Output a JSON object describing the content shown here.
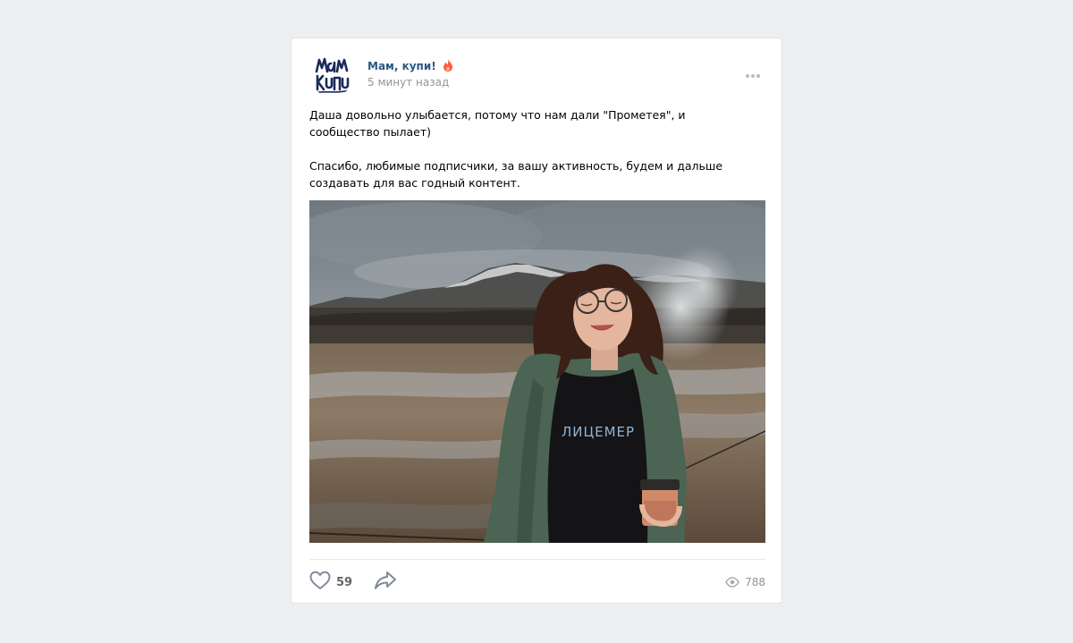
{
  "post": {
    "author": "Мам, купи!",
    "time": "5 минут назад",
    "avatar_text": "мам купи",
    "text_paragraphs": [
      "Даша довольно улыбается, потому что нам дали \"Прометея\", и сообщество пылает)",
      "Спасибо, любимые подписчики, за вашу активность, будем и дальше создавать для вас годный контент."
    ],
    "photo": {
      "shirt_text": "ЛИЦЕМЕР"
    },
    "likes": "59",
    "views": "788"
  },
  "icons": {
    "author_badge": "flame-icon",
    "menu": "more-dots-icon",
    "like": "heart-icon",
    "share": "share-arrow-icon",
    "views": "eye-icon"
  },
  "colors": {
    "page_bg": "#edeef0",
    "author_link": "#2a5885",
    "flame": "#ff5c3c",
    "muted": "#939393"
  }
}
